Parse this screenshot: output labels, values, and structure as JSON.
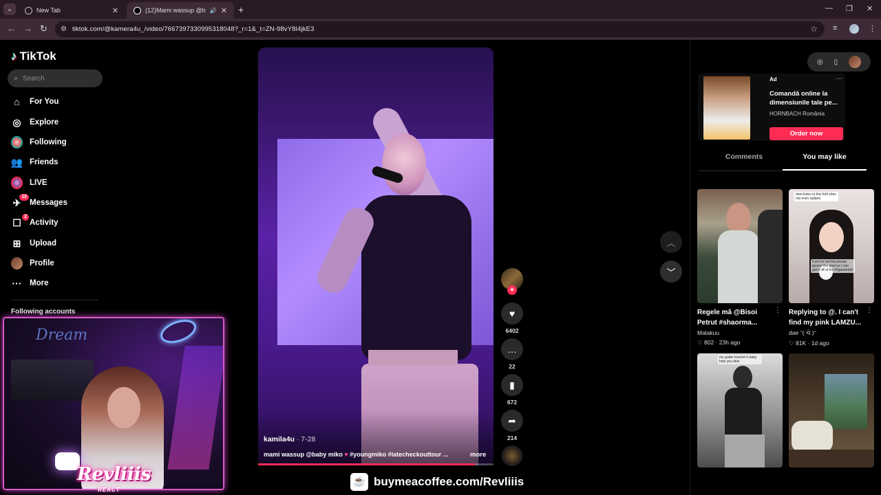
{
  "browser": {
    "tabs": [
      {
        "title": "New Tab",
        "close": "✕"
      },
      {
        "title": "(12)Mami wassup @baby m",
        "close": "✕",
        "audio": "🔊"
      }
    ],
    "new_tab": "+",
    "url": "tiktok.com/@kamera4u_/video/7667397330995318048?_r=1&_t=ZN-98vY8I4jkE3"
  },
  "app": {
    "name": "TikTok",
    "search_placeholder": "Search"
  },
  "nav": [
    {
      "label": "For You",
      "icon": "home-icon",
      "glyph": "⌂"
    },
    {
      "label": "Explore",
      "icon": "compass-icon",
      "glyph": "◎"
    },
    {
      "label": "Following",
      "icon": "following-avatar-icon",
      "glyph": ""
    },
    {
      "label": "Friends",
      "icon": "friends-icon",
      "glyph": "👥"
    },
    {
      "label": "LIVE",
      "icon": "live-icon",
      "glyph": ""
    },
    {
      "label": "Messages",
      "icon": "messages-icon",
      "glyph": "✈",
      "badge": "10"
    },
    {
      "label": "Activity",
      "icon": "activity-icon",
      "glyph": "☐",
      "badge": "2"
    },
    {
      "label": "Upload",
      "icon": "upload-icon",
      "glyph": "⊞"
    },
    {
      "label": "Profile",
      "icon": "profile-avatar-icon",
      "glyph": ""
    },
    {
      "label": "More",
      "icon": "more-icon",
      "glyph": "···"
    }
  ],
  "following_accounts_title": "Following accounts",
  "video": {
    "author": "kamila4u",
    "date": " · 7-28",
    "caption_pre": "mami wassup @baby miko ",
    "caption_heart": "♥",
    "caption_post": " #youngmiko #latecheckouttour ...",
    "more": "more",
    "progress_fraction": 0.92
  },
  "actions": {
    "likes": "6402",
    "comments": "22",
    "saves": "672",
    "shares": "214"
  },
  "ad": {
    "label": "Ad",
    "title": "Comandă online la dimensiunile tale pe...",
    "brand": "HORNBACH România",
    "cta": "Order now"
  },
  "right_tabs": {
    "comments": "Comments",
    "you_may_like": "You may like",
    "active": "you_may_like"
  },
  "cards": [
    {
      "title": "Regele mă @Bisoi Petrut #shaorma...",
      "author": "Malakuu",
      "likes": "802",
      "age": "23h ago"
    },
    {
      "title": "Replying to @. I can't find my pink LAMZU...",
      "author": "dae ᵔ( ᐛ )ᵔ",
      "likes": "81K",
      "age": "1d ago"
    },
    {
      "title": "",
      "author": "",
      "likes": "",
      "age": ""
    },
    {
      "title": "",
      "author": "",
      "likes": "",
      "age": ""
    }
  ],
  "card_overlays": {
    "card2_a": "dont listen to this fold shes not even radiant",
    "card2_b": "if you're normal please ignore this post so I can get it off of for ##gamertok!",
    "card3": "my guitar teacher's baby how you doin"
  },
  "overlay": {
    "streamer_brand": "Revliiis",
    "streamer_sub": "REACT",
    "coffee_url": "buymeacoffee.com/Revliiis",
    "cam_neon": "Dream"
  },
  "colors": {
    "accent": "#fe2c55",
    "cam_border": "#d95ac4"
  }
}
